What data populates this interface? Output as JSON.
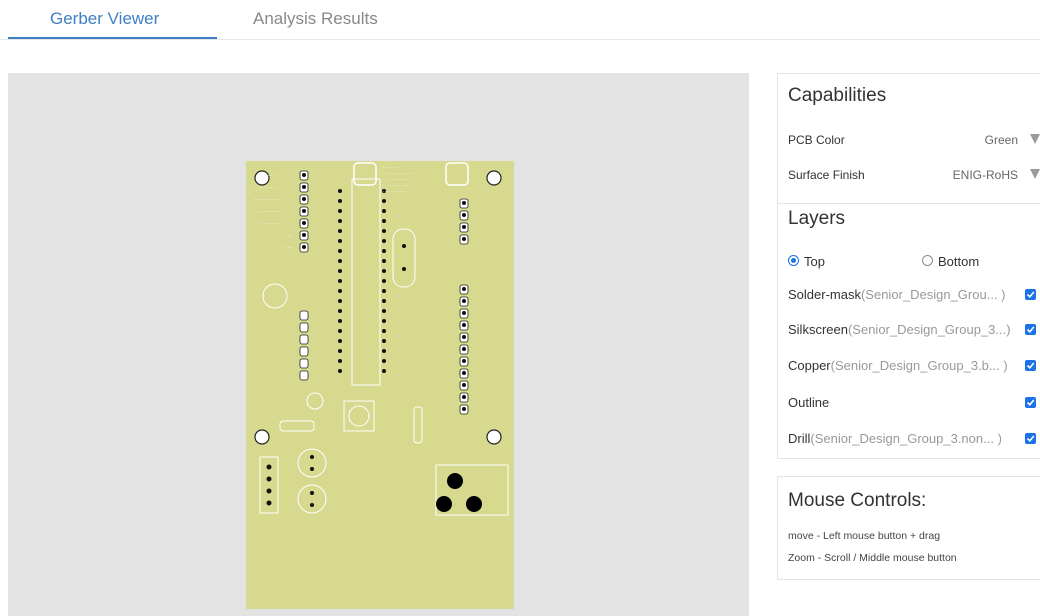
{
  "tabs": {
    "gerber_viewer": "Gerber Viewer",
    "analysis_results": "Analysis Results"
  },
  "capabilities": {
    "title": "Capabilities",
    "pcb_color_label": "PCB Color",
    "pcb_color_value": "Green",
    "surface_finish_label": "Surface Finish",
    "surface_finish_value": "ENIG-RoHS"
  },
  "layers": {
    "title": "Layers",
    "top_label": "Top",
    "bottom_label": "Bottom",
    "selected_side": "Top",
    "items": [
      {
        "name": "Solder-mask",
        "file": "(Senior_Design_Grou... )",
        "checked": true
      },
      {
        "name": "Silkscreen",
        "file": "(Senior_Design_Group_3...)",
        "checked": true
      },
      {
        "name": "Copper",
        "file": "(Senior_Design_Group_3.b... )",
        "checked": true
      },
      {
        "name": "Outline",
        "file": "",
        "checked": true
      },
      {
        "name": "Drill",
        "file": "(Senior_Design_Group_3.non... )",
        "checked": true
      }
    ]
  },
  "mouse_controls": {
    "title": "Mouse Controls:",
    "line1": "move - Left mouse button + drag",
    "line2": "Zoom - Scroll / Middle mouse button"
  },
  "colors": {
    "accent": "#3f7fc5",
    "pcb_board": "#d6d98e",
    "viewer_bg": "#e3e3e3",
    "checkbox": "#1a73e8"
  }
}
